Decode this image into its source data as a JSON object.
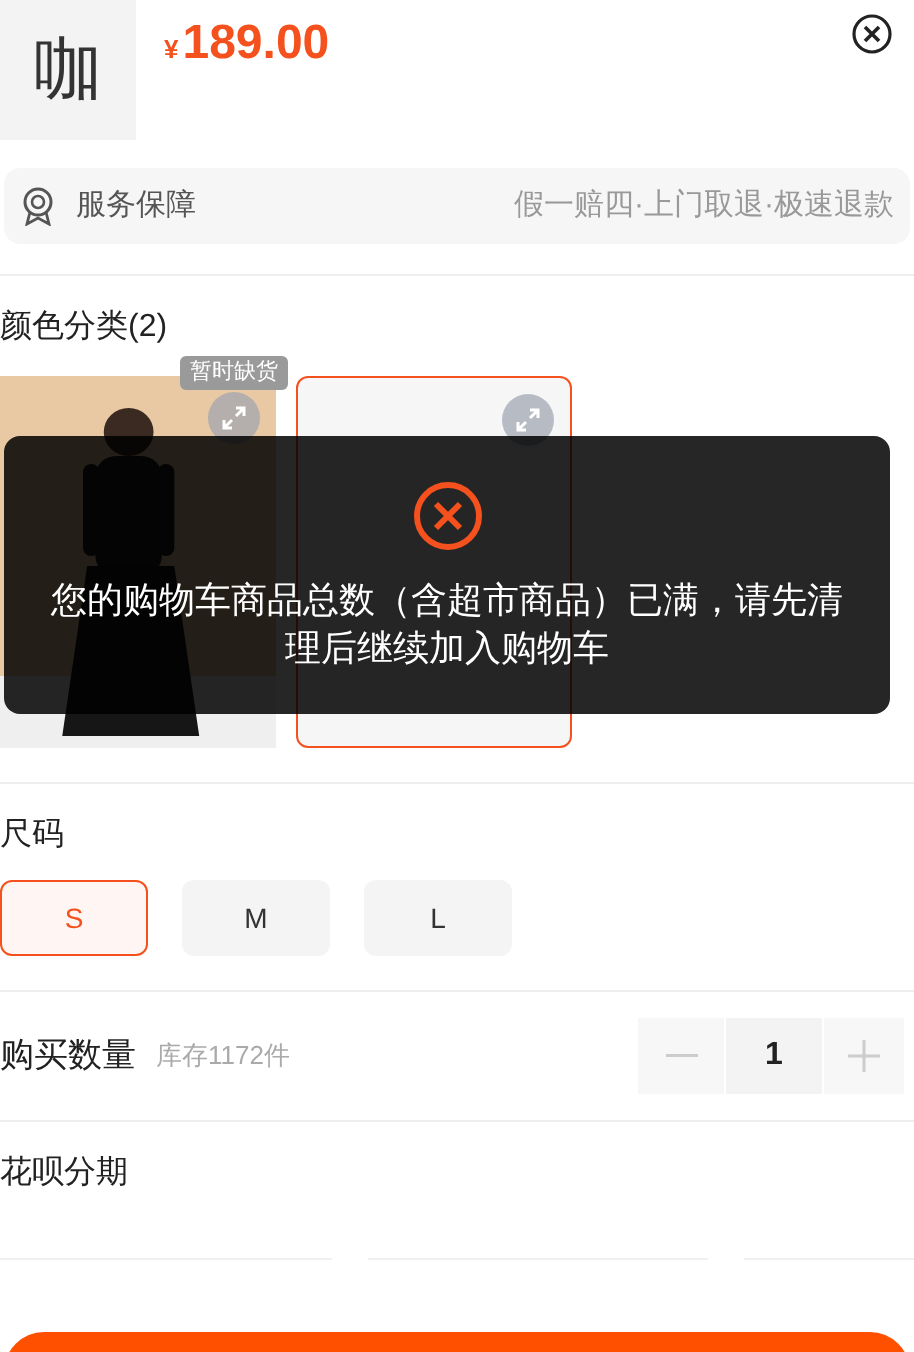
{
  "product": {
    "thumbnail": "咖",
    "price_symbol": "¥",
    "price": "189.00"
  },
  "service": {
    "label": "服务保障",
    "details": "假一赔四·上门取退·极速退款"
  },
  "color": {
    "title": "颜色分类(2)",
    "options": [
      {
        "kind": "picture",
        "badge": "暂时缺货",
        "selected": false
      },
      {
        "kind": "plain",
        "selected": true
      }
    ]
  },
  "size": {
    "title": "尺码",
    "options": [
      {
        "label": "S",
        "selected": true
      },
      {
        "label": "M",
        "selected": false
      },
      {
        "label": "L",
        "selected": false
      }
    ]
  },
  "quantity": {
    "title": "购买数量",
    "stock": "库存1172件",
    "value": "1"
  },
  "installment": {
    "title": "花呗分期"
  },
  "toast": {
    "message": "您的购物车商品总数（含超市商品）已满，请先清理后继续加入购物车"
  }
}
